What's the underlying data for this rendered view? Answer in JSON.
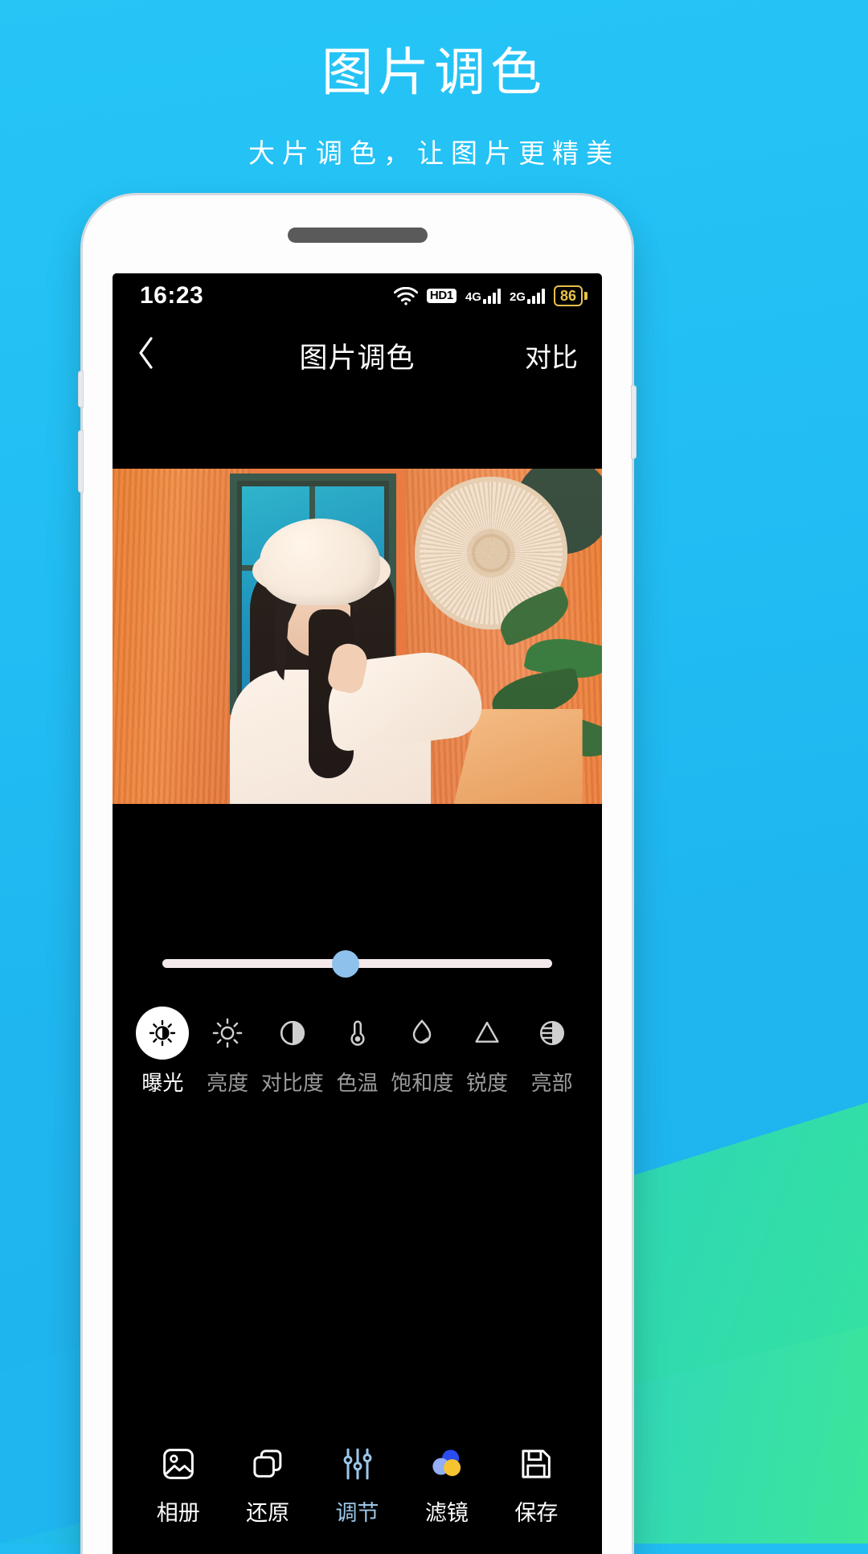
{
  "promo": {
    "title": "图片调色",
    "subtitle": "大片调色，让图片更精美",
    "bg_color": "#22bdf2",
    "accent_green": "#35e39e"
  },
  "status_bar": {
    "time": "16:23",
    "wifi_icon": "wifi-icon",
    "hd_badge": "HD1",
    "network_1": "4G",
    "network_2": "2G",
    "battery_level": "86"
  },
  "nav_bar": {
    "back_icon": "chevron-left-icon",
    "title": "图片调色",
    "compare_label": "对比"
  },
  "slider": {
    "value_percent": 47,
    "track_color": "#f3e9ea",
    "thumb_color": "#8ec2ed"
  },
  "tools": [
    {
      "label": "曝光",
      "icon": "exposure-icon",
      "active": true
    },
    {
      "label": "亮度",
      "icon": "brightness-icon",
      "active": false
    },
    {
      "label": "对比度",
      "icon": "contrast-icon",
      "active": false
    },
    {
      "label": "色温",
      "icon": "temperature-icon",
      "active": false
    },
    {
      "label": "饱和度",
      "icon": "saturation-icon",
      "active": false
    },
    {
      "label": "锐度",
      "icon": "sharpness-icon",
      "active": false
    },
    {
      "label": "亮部",
      "icon": "highlights-icon",
      "active": false
    }
  ],
  "bottom_bar": [
    {
      "label": "相册",
      "icon": "album-icon"
    },
    {
      "label": "还原",
      "icon": "restore-icon"
    },
    {
      "label": "调节",
      "icon": "adjust-sliders-icon"
    },
    {
      "label": "滤镜",
      "icon": "filter-circles-icon"
    },
    {
      "label": "保存",
      "icon": "save-floppy-icon"
    }
  ]
}
